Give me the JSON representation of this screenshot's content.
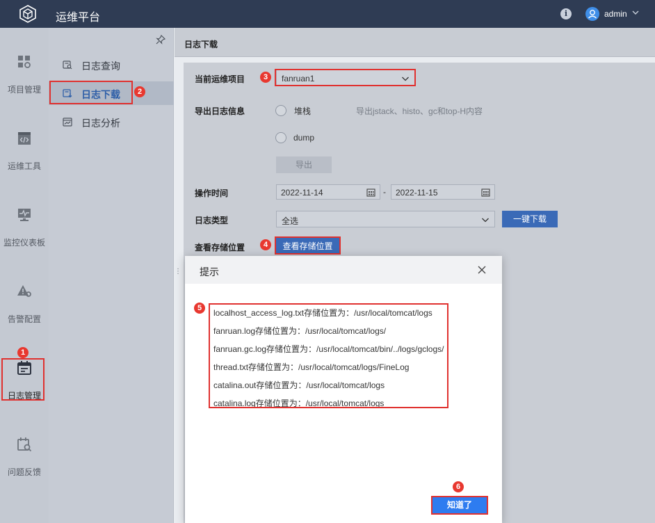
{
  "app": {
    "title": "运维平台",
    "user": "admin",
    "info_icon": "info-icon",
    "user_icon": "user-avatar-icon"
  },
  "rail": {
    "items": [
      {
        "label": "项目管理",
        "icon": "project-grid-icon"
      },
      {
        "label": "运维工具",
        "icon": "code-tool-icon"
      },
      {
        "label": "监控仪表板",
        "icon": "monitor-dashboard-icon"
      },
      {
        "label": "告警配置",
        "icon": "alert-config-icon"
      },
      {
        "label": "日志管理",
        "icon": "log-calendar-icon",
        "active": true
      },
      {
        "label": "问题反馈",
        "icon": "feedback-search-icon"
      }
    ]
  },
  "subnav": {
    "items": [
      {
        "label": "日志查询",
        "icon": "log-search-icon"
      },
      {
        "label": "日志下载",
        "icon": "log-download-icon",
        "active": true
      },
      {
        "label": "日志分析",
        "icon": "log-analysis-icon"
      }
    ]
  },
  "page": {
    "title": "日志下载"
  },
  "form": {
    "project_label": "当前运维项目",
    "project_value": "fanruan1",
    "export_label": "导出日志信息",
    "radio_stack": "堆栈",
    "radio_stack_hint": "导出jstack、histo、gc和top-H内容",
    "radio_dump": "dump",
    "export_button": "导出",
    "time_label": "操作时间",
    "date_start": "2022-11-14",
    "date_sep": "-",
    "date_end": "2022-11-15",
    "type_label": "日志类型",
    "type_value": "全选",
    "download_button": "一键下载",
    "storage_label": "查看存储位置",
    "storage_button": "查看存储位置"
  },
  "dialog": {
    "title": "提示",
    "lines": [
      "localhost_access_log.txt存储位置为：/usr/local/tomcat/logs",
      "fanruan.log存储位置为：/usr/local/tomcat/logs/",
      "fanruan.gc.log存储位置为：/usr/local/tomcat/bin/../logs/gclogs/",
      "thread.txt存储位置为：/usr/local/tomcat/logs/FineLog",
      "catalina.out存储位置为：/usr/local/tomcat/logs",
      "catalina.log存储位置为：/usr/local/tomcat/logs"
    ],
    "ok_button": "知道了"
  },
  "annotations": [
    "1",
    "2",
    "3",
    "4",
    "5",
    "6"
  ],
  "colors": {
    "topbar": "#2f3c54",
    "accent": "#2e7cf0",
    "annotation": "#e0312f"
  }
}
